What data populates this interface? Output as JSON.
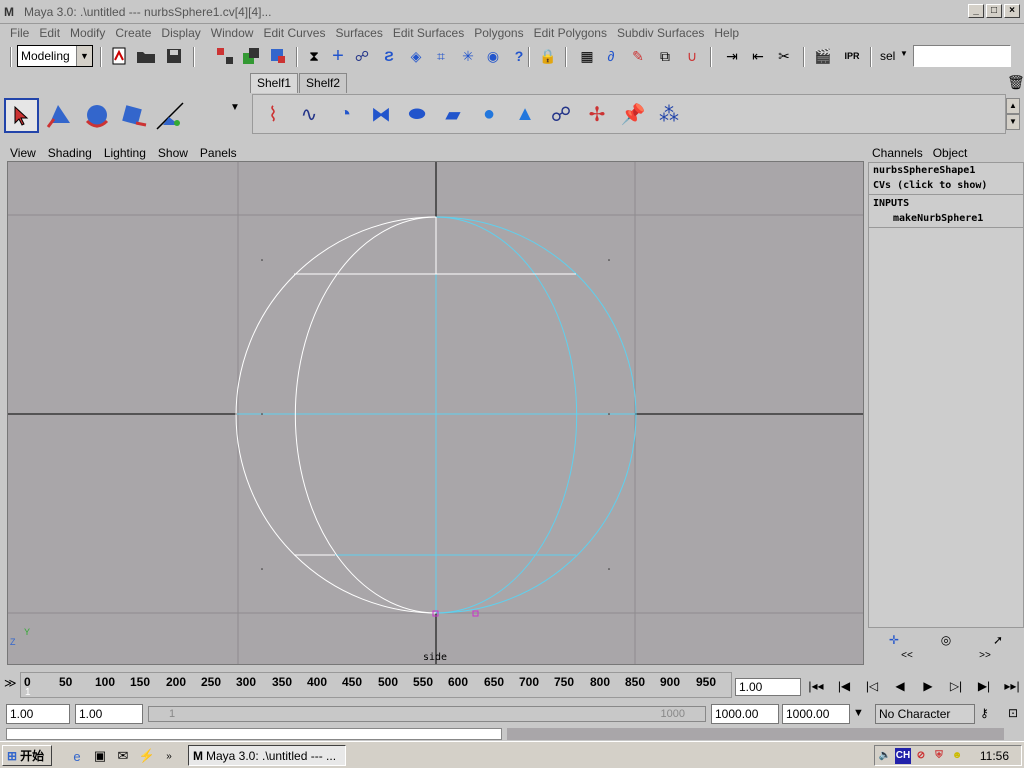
{
  "window": {
    "title": "Maya 3.0: .\\untitled   ---   nurbsSphere1.cv[4][4]...",
    "minimize": "_",
    "maximize": "□",
    "close": "×"
  },
  "menus": [
    "File",
    "Edit",
    "Modify",
    "Create",
    "Display",
    "Window",
    "Edit Curves",
    "Surfaces",
    "Edit Surfaces",
    "Polygons",
    "Edit Polygons",
    "Subdiv Surfaces",
    "Help"
  ],
  "toolbar": {
    "mode": "Modeling",
    "sel_label": "sel",
    "sel_value": ""
  },
  "shelf": {
    "tabs": [
      "Shelf1",
      "Shelf2"
    ],
    "active_tab": "Shelf1"
  },
  "panel_menu": [
    "View",
    "Shading",
    "Lighting",
    "Show",
    "Panels"
  ],
  "viewport": {
    "camera": "side",
    "axis_y": "Y",
    "axis_z": "Z"
  },
  "channel_box": {
    "tabs": [
      "Channels",
      "Object"
    ],
    "shape_name": "nurbsSphereShape1",
    "cvs_row": "CVs (click to show)",
    "inputs_header": "INPUTS",
    "input_node": "makeNurbSphere1",
    "nav_prev": "<<",
    "nav_next": ">>"
  },
  "timeline": {
    "ticks": [
      "0",
      "50",
      "100",
      "150",
      "200",
      "250",
      "300",
      "350",
      "400",
      "450",
      "500",
      "550",
      "600",
      "650",
      "700",
      "750",
      "800",
      "850",
      "900",
      "950"
    ],
    "frame_marker": "1",
    "current_frame": "1.00"
  },
  "range": {
    "start": "1.00",
    "playback_start": "1.00",
    "slider_start": "1",
    "slider_end": "1000",
    "playback_end": "1000.00",
    "end": "1000.00",
    "character": "No Character"
  },
  "taskbar": {
    "start_label": "开始",
    "task_label": "Maya 3.0: .\\untitled  --- ...",
    "tray_lang": "CH",
    "clock": "11:56"
  },
  "colors": {
    "viewport_bg": "#a9a6a9",
    "wire_white": "#ffffff",
    "wire_cyan": "#5fd0ee",
    "cv_magenta": "#cc33cc"
  }
}
